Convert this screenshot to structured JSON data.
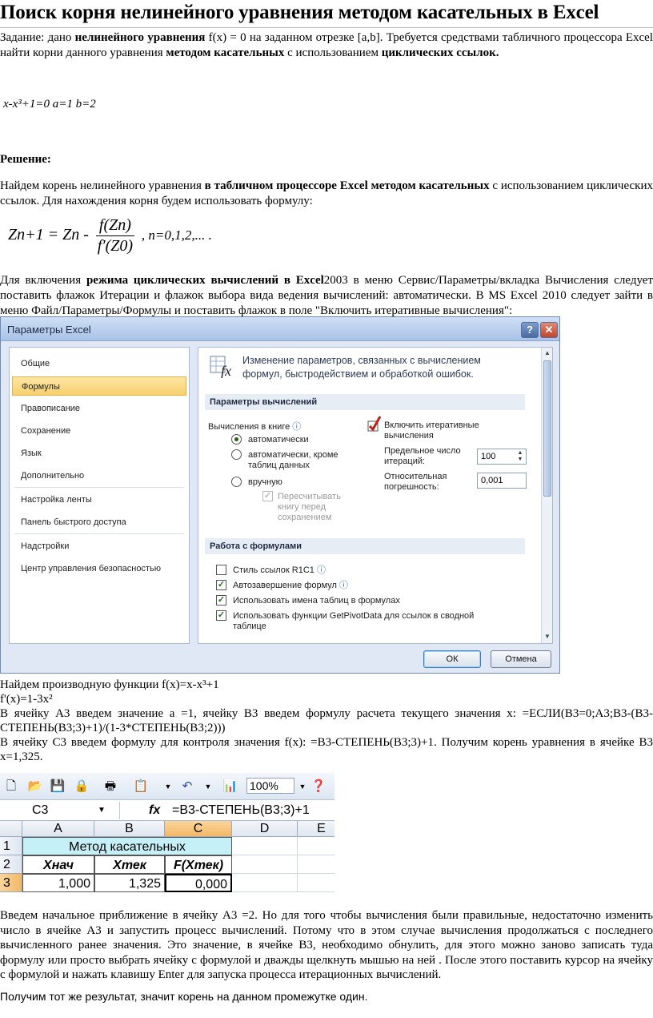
{
  "title": "Поиск корня нелинейного уравнения методом касательных в Excel",
  "task": {
    "t1": "Задание: дано ",
    "b1": "нелинейного уравнения",
    "t2": " f(x) = 0 на заданном отрезке [a,b]. Требуется средствами табличного процессора Excel найти корни данного уравнения ",
    "b2": "методом касательных",
    "t3": " с использованием ",
    "b3": "циклических ссылок."
  },
  "equation": "x-x³+1=0     a=1  b=2",
  "solution_label": "Решение:",
  "intro": {
    "t1": "Найдем корень нелинейного уравнения ",
    "b1": "в табличном процессоре Excel  методом касательных",
    "t2": " с использованием циклических ссылок. Для нахождения корня будем использовать формулу:"
  },
  "formula": {
    "lhs": "Zn+1 = Zn -",
    "num": "f(Zn)",
    "den": "f′(Z0)",
    "tail": ", n=0,1,2,...   ."
  },
  "cyclic": {
    "t1": " Для включения ",
    "b1": "режима циклических вычислений в Excel",
    "t2": "2003 в меню Сервис/Параметры/вкладка Вычисления следует поставить флажок Итерации и флажок выбора вида ведения вычислений: автоматически. В MS Excel 2010 следует зайти в меню Файл/Параметры/Формулы и поставить флажок в поле \"Включить итеративные вычисления\":"
  },
  "dialog": {
    "title": "Параметры Excel",
    "help": "?",
    "close": "✕",
    "nav": [
      "Общие",
      "Формулы",
      "Правописание",
      "Сохранение",
      "Язык",
      "Дополнительно",
      "Настройка ленты",
      "Панель быстрого доступа",
      "Надстройки",
      "Центр управления безопасностью"
    ],
    "header": "Изменение параметров, связанных с вычислением формул, быстродействием и обработкой ошибок.",
    "sec_calc": "Параметры вычислений",
    "calc_in_book": "Вычисления в книге",
    "opt_auto": "автоматически",
    "opt_auto_except": "автоматически, кроме таблиц данных",
    "opt_manual": "вручную",
    "recalc": "Пересчитывать книгу перед сохранением",
    "enable_iter": "Включить итеративные вычисления",
    "max_iter_label": "Предельное число итераций:",
    "max_iter_value": "100",
    "rel_err_label": "Относительная погрешность:",
    "rel_err_value": "0,001",
    "sec_formulas": "Работа с формулами",
    "chk_r1c1": "Стиль ссылок R1C1",
    "chk_autocomplete": "Автозавершение формул",
    "chk_table_names": "Использовать имена таблиц в формулах",
    "chk_getpivot": "Использовать функции GetPivotData для ссылок в сводной таблице",
    "ok": "ОК",
    "cancel": "Отмена"
  },
  "after_dialog": {
    "l1": "Найдем производную функции f(x)=x-x³+1",
    "l2": "f'(x)=1-3x²",
    "l3": "В ячейку А3 введем значение a =1, ячейку В3 введем формулу расчета текущего значения x: =ЕСЛИ(B3=0;A3;B3-(B3-СТЕПЕНЬ(B3;3)+1)/(1-3*СТЕПЕНЬ(B3;2)))",
    "l4": "В ячейку С3 введем формулу для контроля значения f(x): =B3-СТЕПЕНЬ(B3;3)+1. Получим корень уравнения в ячейке В3    x=1,325."
  },
  "excel": {
    "zoom": "100%",
    "namebox": "C3",
    "fx": "fx",
    "formula": "=B3-СТЕПЕНЬ(B3;3)+1",
    "cols": [
      "A",
      "B",
      "C",
      "D",
      "E"
    ],
    "rows": [
      "1",
      "2",
      "3"
    ],
    "merged_title": "Метод касательных",
    "headers": [
      "Хнач",
      "Хтек",
      "F(Хтек)"
    ],
    "values": [
      "1,000",
      "1,325",
      "0,000"
    ]
  },
  "closing": "Введем начальное приближение в ячейку А3 =2. Но для того чтобы вычисления были правильные, недостаточно изменить число в ячейке А3 и запустить процесс вычислений. Потому что в этом случае вычисления продолжаться с последнего вычисленного ранее значения. Это значение,  в ячейке В3, необходимо обнулить, для этого можно заново записать туда формулу или просто выбрать ячейку  с формулой и дважды щелкнуть мышью на ней . После этого поставить курсор на ячейку с формулой и нажать клавишу Enter для запуска процесса итерационных вычислений.",
  "final": "Получим тот же результат, значит корень на данном промежутке один."
}
